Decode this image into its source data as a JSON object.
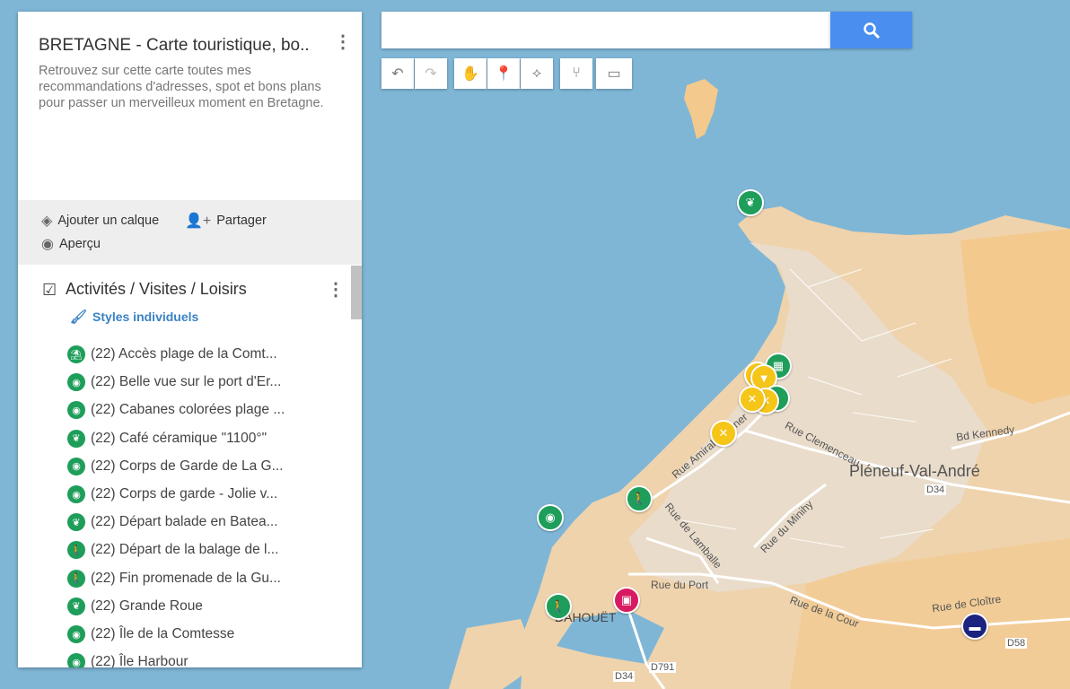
{
  "map": {
    "colors": {
      "water": "#7fb6d6",
      "land": "#efd3ac",
      "landPale": "#f3c98e",
      "urban": "#e9dccb",
      "road": "#ffffff"
    },
    "labels": {
      "town": "Pléneuf-Val-André",
      "dahouet": "DAHOUËT",
      "bd_kennedy": "Bd Kennedy",
      "rue_clemenceau": "Rue Clemenceau",
      "rue_amiral": "Rue Amiral Charner",
      "rue_lamballe": "Rue de Lamballe",
      "rue_minihy": "Rue du Minihy",
      "rue_port": "Rue du Port",
      "rue_cour": "Rue de la Cour",
      "rue_cloitre": "Rue de Cloître",
      "d34a": "D34",
      "d34b": "D34",
      "d58": "D58",
      "d791": "D791"
    }
  },
  "panel": {
    "title": "BRETAGNE - Carte touristique, bo...",
    "description": "Retrouvez sur cette carte toutes mes recommandations d'adresses, spot et bons plans pour passer un merveilleux moment en Bretagne.",
    "actions": {
      "add_layer": "Ajouter un calque",
      "share": "Partager",
      "preview": "Aperçu"
    },
    "layer": {
      "title": "Activités / Visites / Loisirs",
      "styles": "Styles individuels",
      "items": [
        {
          "label": "(22) Accès plage de la Comt...",
          "icon": "beach-icon"
        },
        {
          "label": "(22) Belle vue sur le port d'Er...",
          "icon": "camera-icon"
        },
        {
          "label": "(22) Cabanes colorées plage ...",
          "icon": "camera-icon"
        },
        {
          "label": "(22) Café céramique \"1100°\"",
          "icon": "leaf-icon"
        },
        {
          "label": "(22) Corps de Garde de La G...",
          "icon": "camera-icon"
        },
        {
          "label": "(22) Corps de garde - Jolie v...",
          "icon": "camera-icon"
        },
        {
          "label": "(22) Départ balade en Batea...",
          "icon": "leaf-icon"
        },
        {
          "label": "(22) Départ de la balage de l...",
          "icon": "hiker-icon"
        },
        {
          "label": "(22) Fin promenade de la Gu...",
          "icon": "hiker-icon"
        },
        {
          "label": "(22) Grande Roue",
          "icon": "leaf-icon"
        },
        {
          "label": "(22) Île de la Comtesse",
          "icon": "camera-icon"
        },
        {
          "label": "(22) Île Harbour",
          "icon": "camera-icon"
        }
      ]
    }
  }
}
